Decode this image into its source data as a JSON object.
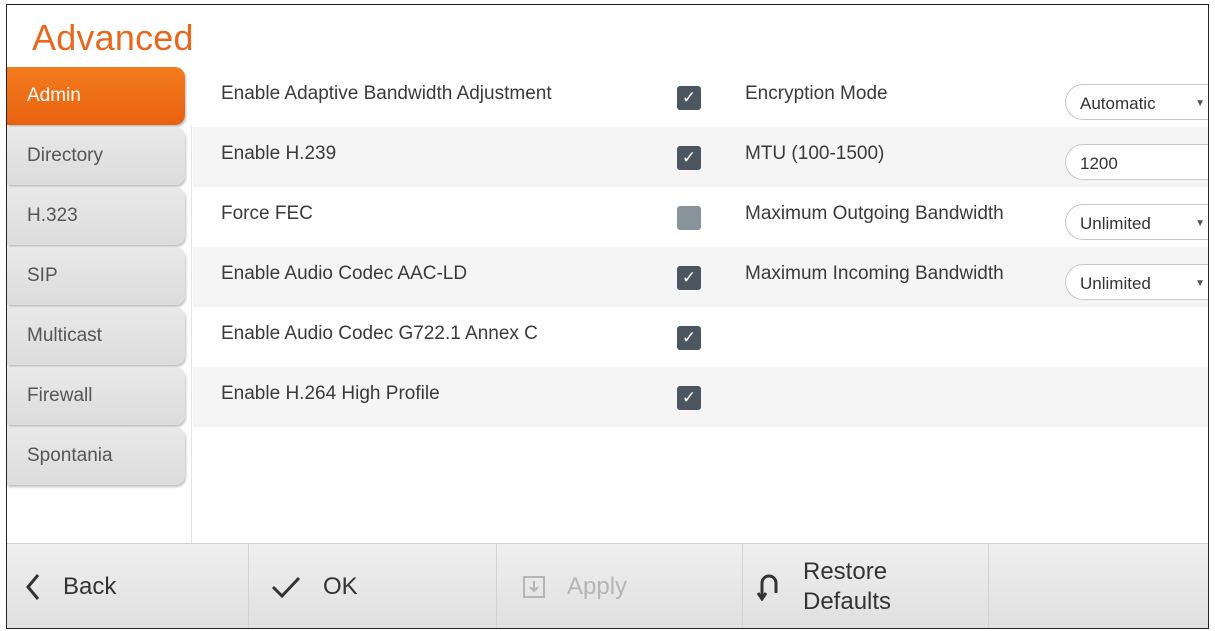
{
  "page": {
    "title": "Advanced"
  },
  "sidebar": {
    "items": [
      {
        "label": "Admin",
        "active": true
      },
      {
        "label": "Directory"
      },
      {
        "label": "H.323"
      },
      {
        "label": "SIP"
      },
      {
        "label": "Multicast"
      },
      {
        "label": "Firewall"
      },
      {
        "label": "Spontania"
      }
    ]
  },
  "settings": {
    "left": [
      {
        "label": "Enable Adaptive Bandwidth Adjustment",
        "checked": true
      },
      {
        "label": "Enable H.239",
        "checked": true
      },
      {
        "label": "Force FEC",
        "checked": false
      },
      {
        "label": "Enable Audio Codec AAC-LD",
        "checked": true
      },
      {
        "label": "Enable Audio Codec G722.1 Annex C",
        "checked": true
      },
      {
        "label": "Enable H.264 High Profile",
        "checked": true
      }
    ],
    "right": [
      {
        "label": "Encryption Mode",
        "value": "Automatic",
        "type": "select"
      },
      {
        "label": "MTU (100-1500)",
        "value": "1200",
        "type": "input"
      },
      {
        "label": "Maximum Outgoing Bandwidth",
        "value": "Unlimited",
        "type": "select"
      },
      {
        "label": "Maximum Incoming Bandwidth",
        "value": "Unlimited",
        "type": "select"
      }
    ]
  },
  "footer": {
    "back": "Back",
    "ok": "OK",
    "apply": "Apply",
    "restore_line1": "Restore",
    "restore_line2": "Defaults"
  },
  "colors": {
    "accent": "#e8691d",
    "checkbox": "#4b5660"
  },
  "icons": {
    "back": "chevron-left-icon",
    "ok": "checkmark-icon",
    "apply": "apply-icon",
    "restore": "restore-icon",
    "dropdown": "caret-down-icon"
  }
}
